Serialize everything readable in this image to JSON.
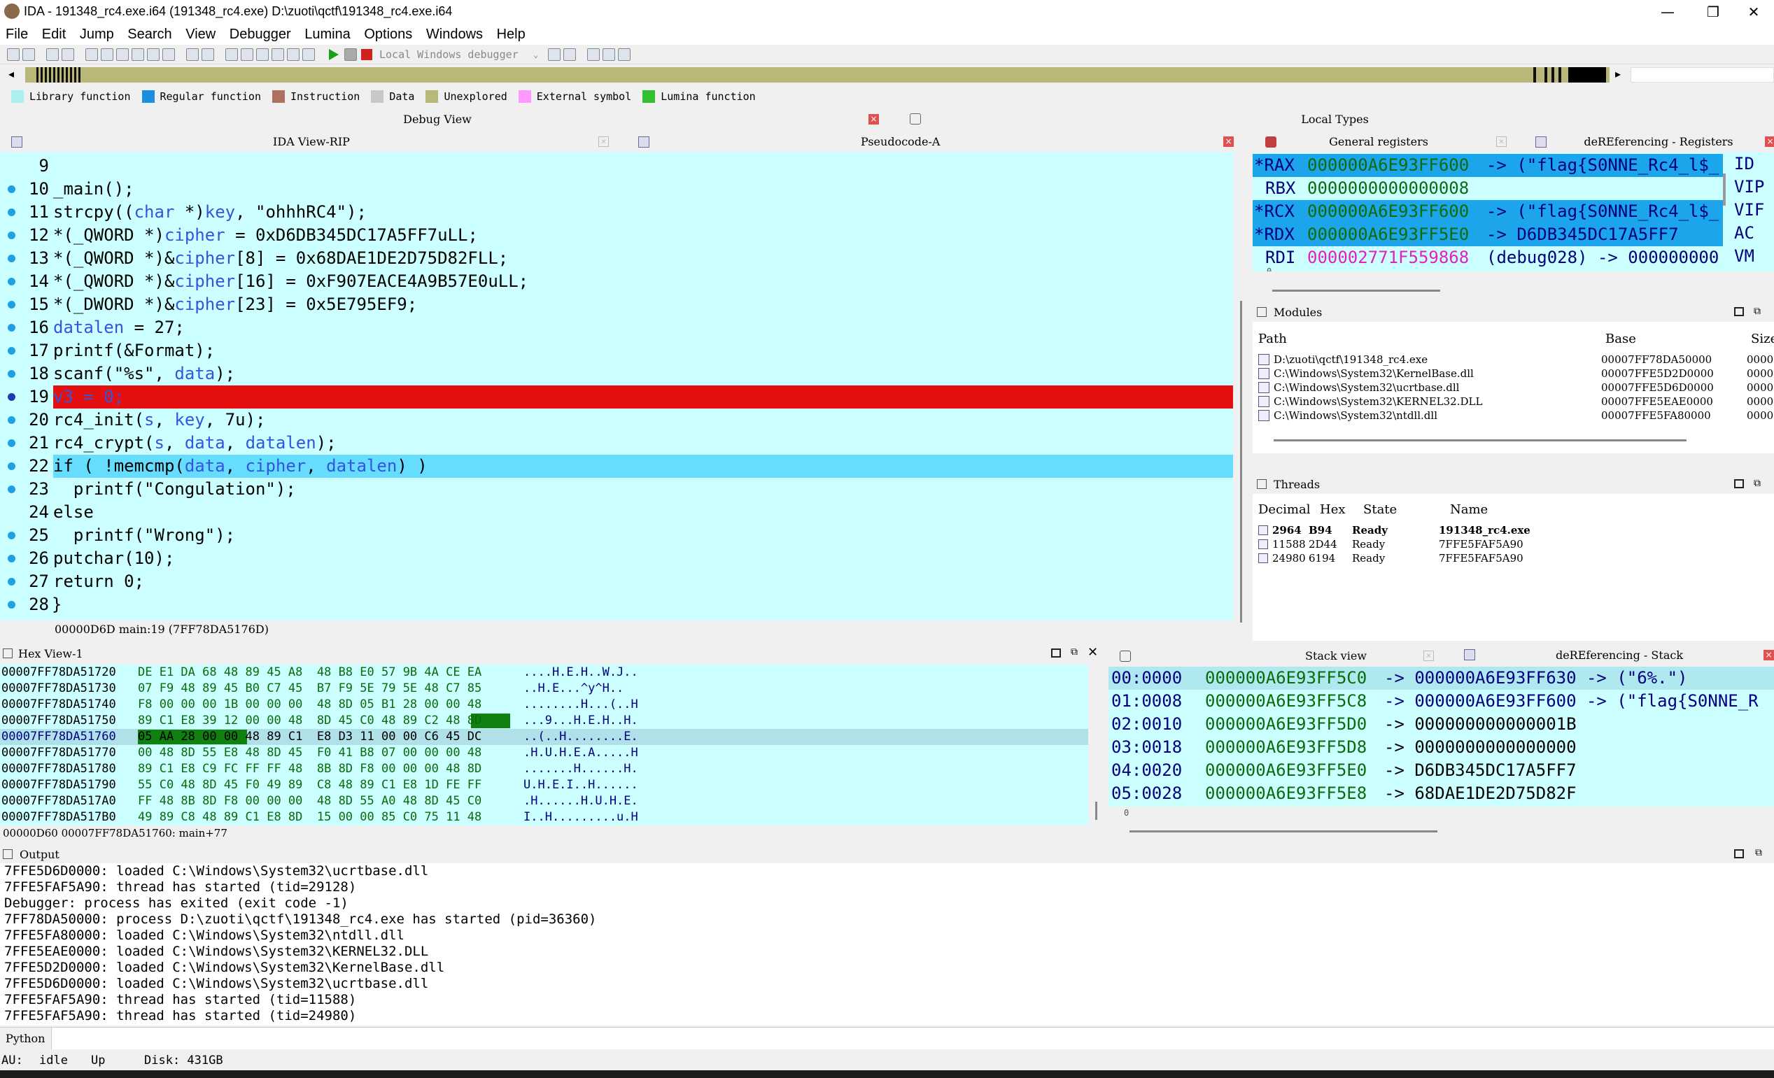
{
  "window": {
    "title": "IDA - 191348_rc4.exe.i64 (191348_rc4.exe) D:\\zuoti\\qctf\\191348_rc4.exe.i64",
    "min": "—",
    "max": "❐",
    "close": "✕"
  },
  "menu": [
    "File",
    "Edit",
    "Jump",
    "Search",
    "View",
    "Debugger",
    "Lumina",
    "Options",
    "Windows",
    "Help"
  ],
  "toolbar": {
    "debugger_select": "Local Windows debugger"
  },
  "legend": [
    {
      "label": "Library function",
      "color": "#aaf0f0"
    },
    {
      "label": "Regular function",
      "color": "#1a8fe0"
    },
    {
      "label": "Instruction",
      "color": "#b07060"
    },
    {
      "label": "Data",
      "color": "#c8c8c8"
    },
    {
      "label": "Unexplored",
      "color": "#b8b878"
    },
    {
      "label": "External symbol",
      "color": "#ff99ff"
    },
    {
      "label": "Lumina function",
      "color": "#30c030"
    }
  ],
  "tabs": {
    "debug_view": "Debug View",
    "local_types": "Local Types",
    "ida_view": "IDA View-RIP",
    "pseudocode": "Pseudocode-A",
    "general_registers": "General registers",
    "deref_registers": "deREferencing - Registers",
    "modules": "Modules",
    "threads": "Threads",
    "hex_view": "Hex View-1",
    "stack_view": "Stack view",
    "deref_stack": "deREferencing - Stack",
    "output": "Output"
  },
  "code": [
    {
      "n": "9",
      "t": ""
    },
    {
      "n": "10",
      "t": "_main();"
    },
    {
      "n": "11",
      "t": "strcpy((char *)key, \"ohhhRC4\");"
    },
    {
      "n": "12",
      "t": "*(_QWORD *)cipher = 0xD6DB345DC17A5FF7uLL;"
    },
    {
      "n": "13",
      "t": "*(_QWORD *)&cipher[8] = 0x68DAE1DE2D75D82FLL;"
    },
    {
      "n": "14",
      "t": "*(_QWORD *)&cipher[16] = 0xF907EACE4A9B57E0uLL;"
    },
    {
      "n": "15",
      "t": "*(_DWORD *)&cipher[23] = 0x5E795EF9;"
    },
    {
      "n": "16",
      "t": "datalen = 27;"
    },
    {
      "n": "17",
      "t": "printf(&Format);"
    },
    {
      "n": "18",
      "t": "scanf(\"%s\", data);"
    },
    {
      "n": "19",
      "t": "v3 = 0;"
    },
    {
      "n": "20",
      "t": "rc4_init(s, key, 7u);"
    },
    {
      "n": "21",
      "t": "rc4_crypt(s, data, datalen);"
    },
    {
      "n": "22",
      "t": "if ( !memcmp(data, cipher, datalen) )"
    },
    {
      "n": "23",
      "t": "  printf(\"Congulation\");"
    },
    {
      "n": "24",
      "t": "else"
    },
    {
      "n": "25",
      "t": "  printf(\"Wrong\");"
    },
    {
      "n": "26",
      "t": "putchar(10);"
    },
    {
      "n": "27",
      "t": "return 0;"
    },
    {
      "n": "28",
      "t": "}"
    }
  ],
  "code_status": "00000D6D main:19 (7FF78DA5176D)",
  "registers": [
    {
      "name": "*RAX",
      "val": "000000A6E93FF600",
      "rest": "-> (\"flag{S0NNE_Rc4_l$_"
    },
    {
      "name": "RBX",
      "val": "0000000000000008",
      "rest": ""
    },
    {
      "name": "*RCX",
      "val": "000000A6E93FF600",
      "rest": "-> (\"flag{S0NNE_Rc4_l$_"
    },
    {
      "name": "*RDX",
      "val": "000000A6E93FF5E0",
      "rest": "-> D6DB345DC17A5FF7"
    },
    {
      "name": "RDI",
      "val": "000002771F559868",
      "rest": "(debug028) -> 000000000"
    }
  ],
  "flags": [
    "ID",
    "VIP",
    "VIF",
    "AC",
    "VM"
  ],
  "modules": {
    "headers": [
      "Path",
      "Base",
      "Size"
    ],
    "rows": [
      {
        "path": "D:\\zuoti\\qctf\\191348_rc4.exe",
        "base": "00007FF78DA50000",
        "size": "0000"
      },
      {
        "path": "C:\\Windows\\System32\\KernelBase.dll",
        "base": "00007FFE5D2D0000",
        "size": "0000"
      },
      {
        "path": "C:\\Windows\\System32\\ucrtbase.dll",
        "base": "00007FFE5D6D0000",
        "size": "0000"
      },
      {
        "path": "C:\\Windows\\System32\\KERNEL32.DLL",
        "base": "00007FFE5EAE0000",
        "size": "0000"
      },
      {
        "path": "C:\\Windows\\System32\\ntdll.dll",
        "base": "00007FFE5FA80000",
        "size": "0000"
      }
    ]
  },
  "threads": {
    "headers": [
      "Decimal",
      "Hex",
      "State",
      "Name"
    ],
    "rows": [
      {
        "dec": "2964",
        "hex": "B94",
        "state": "Ready",
        "name": "191348_rc4.exe"
      },
      {
        "dec": "11588",
        "hex": "2D44",
        "state": "Ready",
        "name": "7FFE5FAF5A90"
      },
      {
        "dec": "24980",
        "hex": "6194",
        "state": "Ready",
        "name": "7FFE5FAF5A90"
      }
    ]
  },
  "hex": [
    {
      "a": "00007FF78DA51720",
      "b": "DE E1 DA 68 48 89 45 A8  48 B8 E0 57 9B 4A CE EA",
      "c": "....H.E.H..W.J.."
    },
    {
      "a": "00007FF78DA51730",
      "b": "07 F9 48 89 45 B0 C7 45  B7 F9 5E 79 5E 48 C7 85",
      "c": "..H.E...^y^H.."
    },
    {
      "a": "00007FF78DA51740",
      "b": "F8 00 00 00 1B 00 00 00  48 8D 05 B1 28 00 00 48",
      "c": "........H...(..H"
    },
    {
      "a": "00007FF78DA51750",
      "b": "89 C1 E8 39 12 00 00 48  8D 45 C0 48 89 C2 48 8D",
      "c": "...9...H.E.H..H."
    },
    {
      "a": "00007FF78DA51760",
      "b": "05 AA 28 00 00 48 89 C1  E8 D3 11 00 00 C6 45 DC",
      "c": "..(..H........E."
    },
    {
      "a": "00007FF78DA51770",
      "b": "00 48 8D 55 E8 48 8D 45  F0 41 B8 07 00 00 00 48",
      "c": ".H.U.H.E.A.....H"
    },
    {
      "a": "00007FF78DA51780",
      "b": "89 C1 E8 C9 FC FF FF 48  8B 8D F8 00 00 00 48 8D",
      "c": ".......H......H."
    },
    {
      "a": "00007FF78DA51790",
      "b": "55 C0 48 8D 45 F0 49 89  C8 48 89 C1 E8 1D FE FF",
      "c": "U.H.E.I..H......"
    },
    {
      "a": "00007FF78DA517A0",
      "b": "FF 48 8B 8D F8 00 00 00  48 8D 55 A0 48 8D 45 C0",
      "c": ".H......H.U.H.E."
    },
    {
      "a": "00007FF78DA517B0",
      "b": "49 89 C8 48 89 C1 E8 8D  15 00 00 85 C0 75 11 48",
      "c": "I..H.........u.H"
    }
  ],
  "hex_status": "00000D60 00007FF78DA51760: main+77",
  "stack": [
    {
      "o": "00:0000",
      "a": "000000A6E93FF5C0",
      "r": "-> 000000A6E93FF630 -> (\"6%.\")"
    },
    {
      "o": "01:0008",
      "a": "000000A6E93FF5C8",
      "r": "-> 000000A6E93FF600 -> (\"flag{S0NNE_R"
    },
    {
      "o": "02:0010",
      "a": "000000A6E93FF5D0",
      "r": "-> 000000000000001B"
    },
    {
      "o": "03:0018",
      "a": "000000A6E93FF5D8",
      "r": "-> 0000000000000000"
    },
    {
      "o": "04:0020",
      "a": "000000A6E93FF5E0",
      "r": "-> D6DB345DC17A5FF7"
    },
    {
      "o": "05:0028",
      "a": "000000A6E93FF5E8",
      "r": "-> 68DAE1DE2D75D82F"
    }
  ],
  "output": [
    "7FFE5D6D0000: loaded C:\\Windows\\System32\\ucrtbase.dll",
    "7FFE5FAF5A90: thread has started (tid=29128)",
    "Debugger: process has exited (exit code -1)",
    "7FF78DA50000: process D:\\zuoti\\qctf\\191348_rc4.exe has started (pid=36360)",
    "7FFE5FA80000: loaded C:\\Windows\\System32\\ntdll.dll",
    "7FFE5EAE0000: loaded C:\\Windows\\System32\\KERNEL32.DLL",
    "7FFE5D2D0000: loaded C:\\Windows\\System32\\KernelBase.dll",
    "7FFE5D6D0000: loaded C:\\Windows\\System32\\ucrtbase.dll",
    "7FFE5FAF5A90: thread has started (tid=11588)",
    "7FFE5FAF5A90: thread has started (tid=24980)"
  ],
  "python_label": "Python",
  "status": {
    "au": "AU:",
    "state": "idle",
    "dir": "Up",
    "disk": "Disk: 431GB"
  },
  "misc": {
    "zero": "0"
  }
}
